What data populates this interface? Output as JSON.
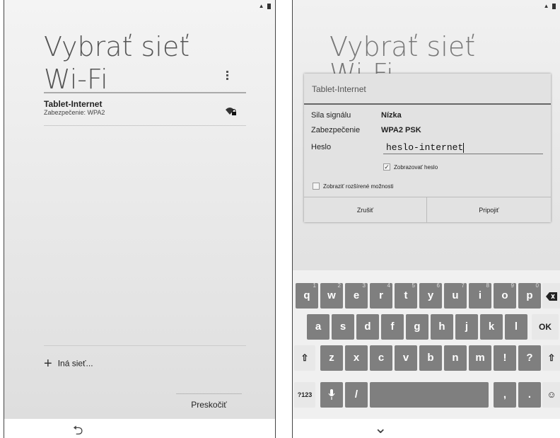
{
  "left": {
    "title_line1": "Vybrať sieť",
    "title_line2": "Wi-Fi",
    "network": {
      "name": "Tablet-Internet",
      "security": "Zabezpečenie: WPA2"
    },
    "other_network": "Iná sieť...",
    "skip_button": "Preskočiť"
  },
  "right": {
    "title_line1": "Vybrať sieť",
    "title_line2": "Wi-Fi",
    "dialog": {
      "title": "Tablet-Internet",
      "signal_label": "Sila signálu",
      "signal_value": "Nízka",
      "security_label": "Zabezpečenie",
      "security_value": "WPA2 PSK",
      "password_label": "Heslo",
      "password_value": "heslo-internet",
      "show_password": "Zobrazovať heslo",
      "show_password_checked": true,
      "advanced_options": "Zobraziť rozšírené možnosti",
      "advanced_options_checked": false,
      "cancel_button": "Zrušiť",
      "connect_button": "Pripojiť"
    },
    "keyboard": {
      "row1": [
        "q",
        "w",
        "e",
        "r",
        "t",
        "y",
        "u",
        "i",
        "o",
        "p"
      ],
      "row1_numbers": [
        "1",
        "2",
        "3",
        "4",
        "5",
        "6",
        "7",
        "8",
        "9",
        "0"
      ],
      "row2": [
        "a",
        "s",
        "d",
        "f",
        "g",
        "h",
        "j",
        "k",
        "l"
      ],
      "row2_ok": "OK",
      "row3": [
        "z",
        "x",
        "c",
        "v",
        "b",
        "n",
        "m",
        "!",
        "?"
      ],
      "symbols_key": "?123",
      "slash_key": "/",
      "comma_key": ",",
      "period_key": ".",
      "icons": [
        "backspace-icon",
        "shift-icon",
        "microphone-icon",
        "emoji-icon"
      ]
    }
  },
  "nav": {
    "back_icon": "back-icon",
    "hide_keyboard_icon": "chevron-down-icon"
  },
  "colors": {
    "key": "#7f7f7f",
    "background_top": "#f4f4f4",
    "background_bottom": "#dddddd",
    "dialog": "#e2e2e2"
  }
}
